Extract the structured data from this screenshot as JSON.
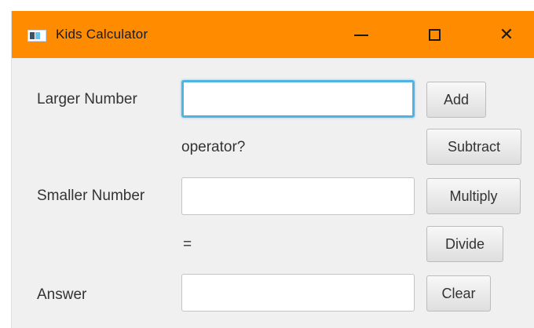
{
  "window": {
    "title": "Kids Calculator",
    "title_bar_color": "#ff8c00",
    "controls": {
      "minimize_icon": "minimize-icon",
      "maximize_icon": "maximize-icon",
      "close_icon": "close-icon",
      "close_glyph": "✕"
    }
  },
  "form": {
    "larger_number_label": "Larger Number",
    "larger_number_value": "",
    "operator_label": "operator?",
    "smaller_number_label": "Smaller Number",
    "smaller_number_value": "",
    "equals_label": "=",
    "answer_label": "Answer",
    "answer_value": ""
  },
  "buttons": {
    "add": "Add",
    "subtract": "Subtract",
    "multiply": "Multiply",
    "divide": "Divide",
    "clear": "Clear"
  },
  "focus_color": "#4fb4e3"
}
